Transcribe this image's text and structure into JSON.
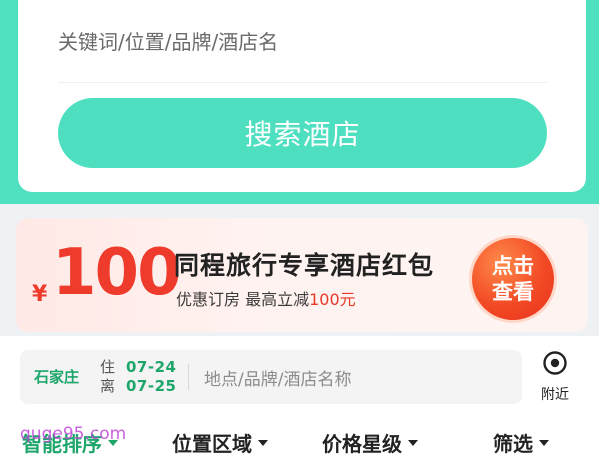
{
  "search": {
    "keyword_placeholder": "关键词/位置/品牌/酒店名",
    "button_label": "搜索酒店"
  },
  "banner": {
    "currency": "¥",
    "amount": "100",
    "title": "同程旅行专享酒店红包",
    "subtitle_prefix": "优惠订房  最高立减",
    "subtitle_highlight": "100元",
    "cta_line1": "点击",
    "cta_line2": "查看"
  },
  "location": {
    "city": "石家庄",
    "checkin_label": "住",
    "checkout_label": "离",
    "checkin_date": "07-24",
    "checkout_date": "07-25",
    "hotel_placeholder": "地点/品牌/酒店名称",
    "nearby_label": "附近",
    "nearby_icon": "location-pin-icon"
  },
  "filters": [
    {
      "label": "智能排序",
      "active": true
    },
    {
      "label": "位置区域",
      "active": false
    },
    {
      "label": "价格星级",
      "active": false
    },
    {
      "label": "筛选",
      "active": false
    }
  ],
  "watermark": "quge95.com",
  "colors": {
    "accent_teal": "#4fe0c0",
    "accent_green": "#1ea66a",
    "promo_red": "#ee3b2b"
  }
}
